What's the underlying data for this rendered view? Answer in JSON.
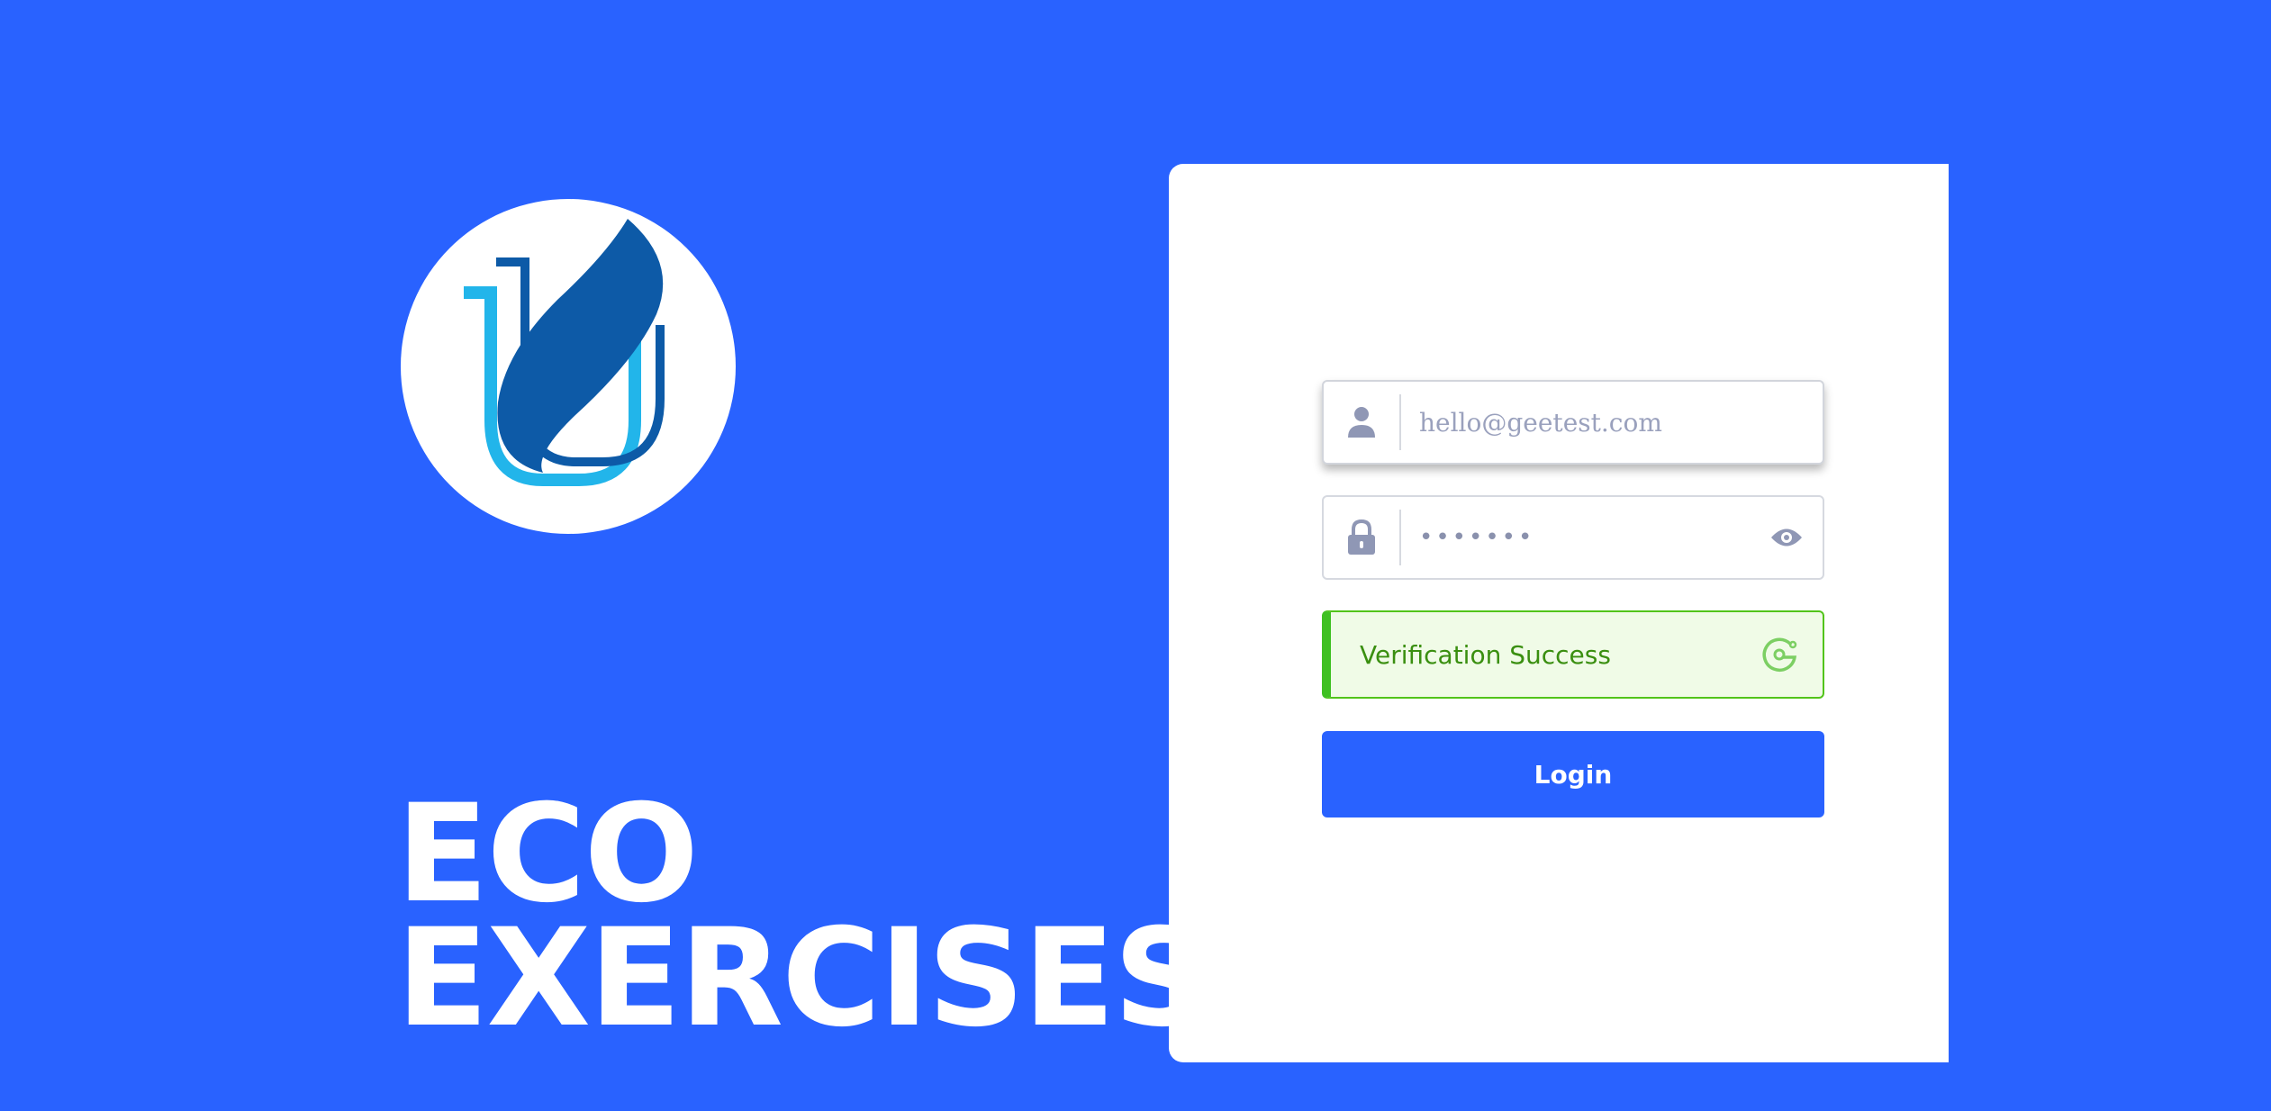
{
  "colors": {
    "background": "#2962ff",
    "card": "#ffffff",
    "verify_bg": "#f0fbe7",
    "verify_border": "#52c41a",
    "verify_text": "#3a8f10",
    "button": "#2962ff"
  },
  "brand": {
    "logo_icon": "leaf-shield-logo",
    "title_line1": "ECO",
    "title_line2": "EXERCISES"
  },
  "form": {
    "email": {
      "icon": "user-icon",
      "value": "hello@geetest.com"
    },
    "password": {
      "icon": "lock-icon",
      "value": "•••••••",
      "toggle_icon": "eye-icon"
    },
    "captcha": {
      "status_text": "Verification Success",
      "icon": "geetest-icon"
    },
    "login_label": "Login"
  }
}
